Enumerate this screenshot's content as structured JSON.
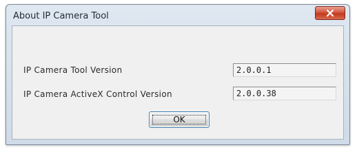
{
  "window": {
    "title": "About IP Camera Tool"
  },
  "info": {
    "tool_version_label": "IP Camera Tool Version",
    "tool_version_value": "2.0.0.1",
    "activex_version_label": "IP Camera ActiveX Control Version",
    "activex_version_value": "2.0.0.38"
  },
  "buttons": {
    "ok_label": "OK"
  },
  "icons": {
    "close": "close-icon"
  },
  "colors": {
    "close_button": "#c94a32",
    "title_bar": "#dfe8f1",
    "dialog_face": "#f0f0f0"
  }
}
